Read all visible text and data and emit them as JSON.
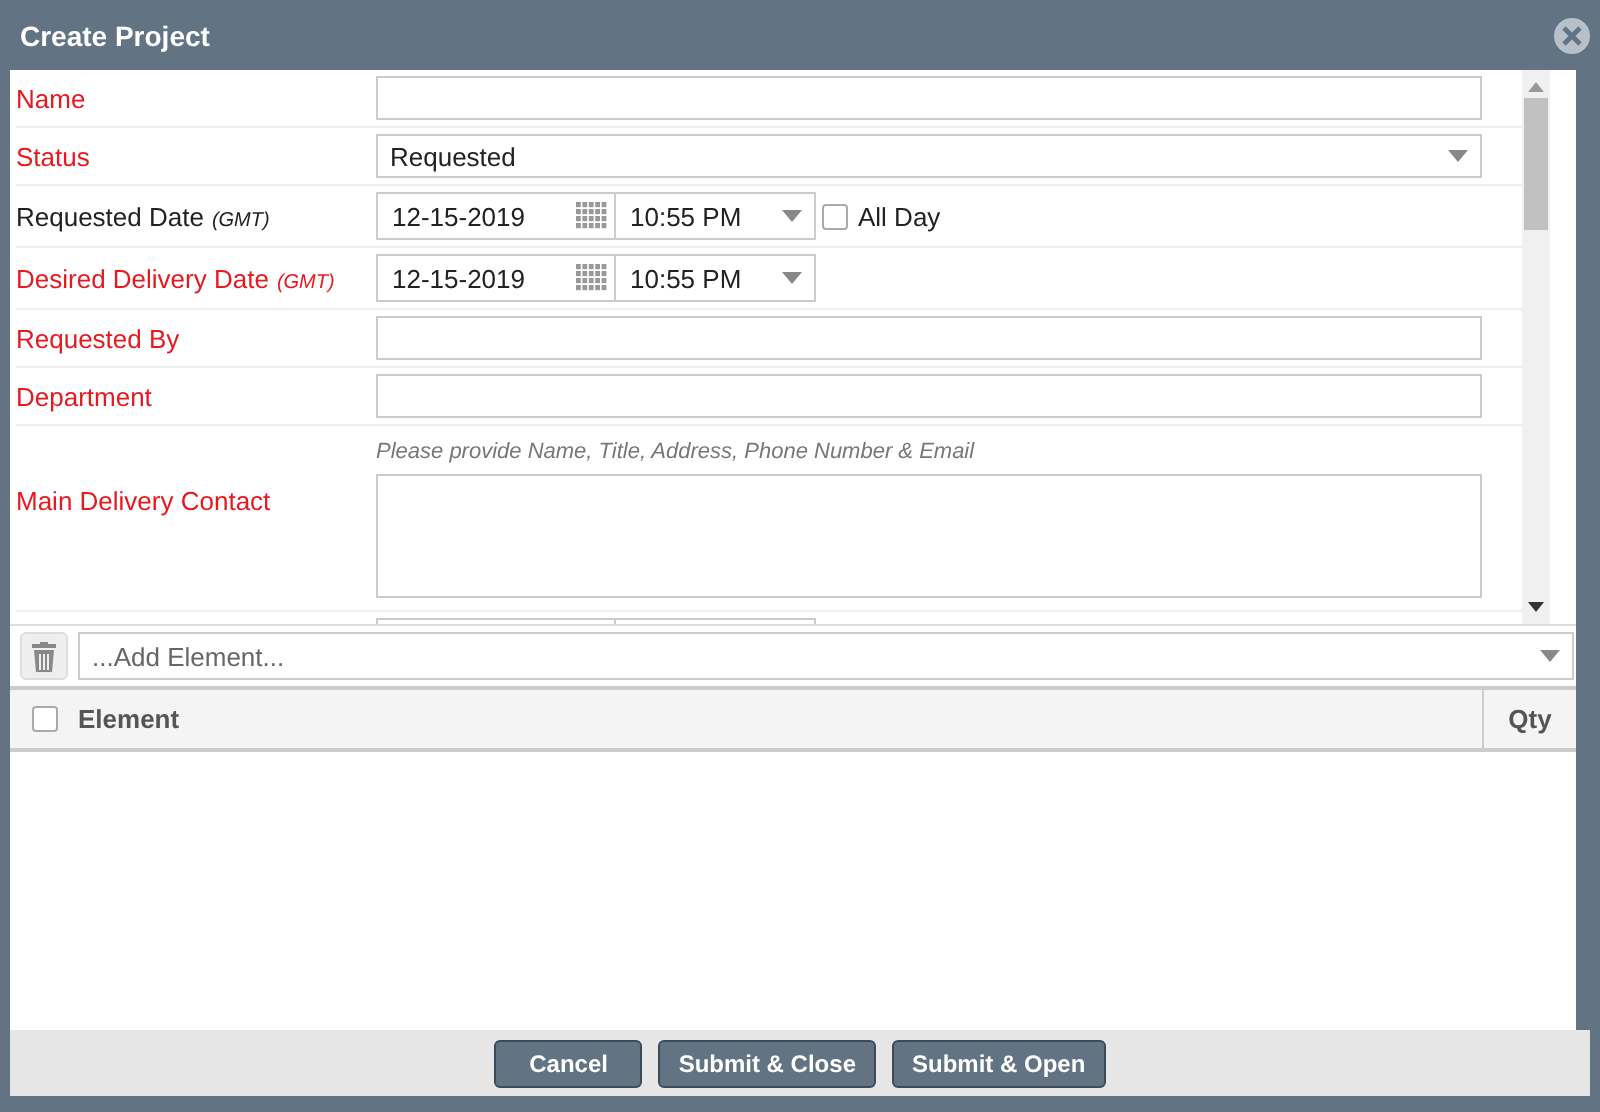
{
  "window": {
    "title": "Create Project"
  },
  "fields": [
    {
      "kind": "text",
      "label": "Name",
      "required": true
    },
    {
      "kind": "select",
      "label": "Status",
      "required": true,
      "value": "Requested"
    },
    {
      "kind": "datetime",
      "label": "Requested Date",
      "suffix": "(GMT)",
      "required": false,
      "date": "12-15-2019",
      "time": "10:55 PM",
      "all_day": {
        "label": "All Day",
        "checked": false
      }
    },
    {
      "kind": "datetime",
      "label": "Desired Delivery Date",
      "suffix": "(GMT)",
      "required": true,
      "date": "12-15-2019",
      "time": "10:55 PM"
    },
    {
      "kind": "text",
      "label": "Requested By",
      "required": true
    },
    {
      "kind": "text",
      "label": "Department",
      "required": true
    },
    {
      "kind": "textarea",
      "label": "Main Delivery Contact",
      "required": true,
      "hint": "Please provide Name, Title, Address, Phone Number & Email"
    },
    {
      "kind": "datetime"
    }
  ],
  "element_picker": {
    "placeholder": "...Add Element..."
  },
  "table": {
    "columns": [
      "Element",
      "Qty"
    ],
    "select_all": {
      "checked": false
    }
  },
  "buttons": [
    "Cancel",
    "Submit & Close",
    "Submit & Open"
  ]
}
